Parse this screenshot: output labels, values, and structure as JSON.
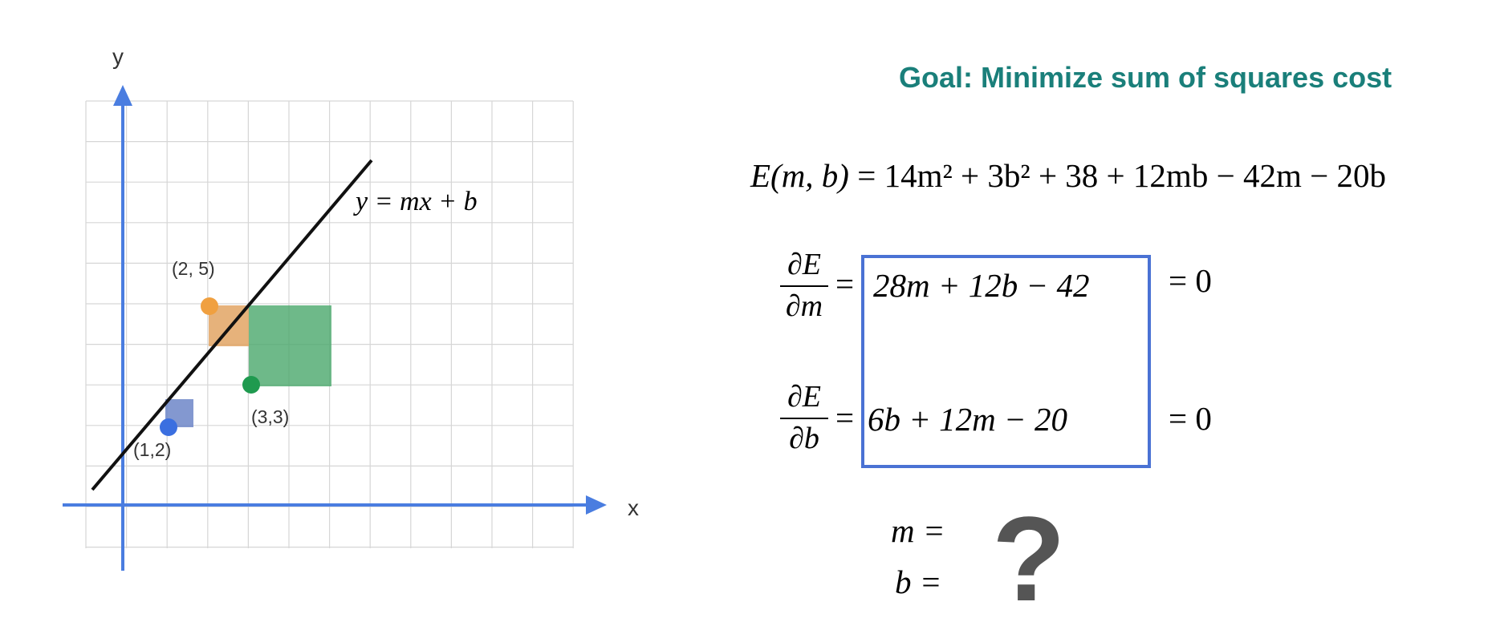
{
  "plot": {
    "x_axis_label": "x",
    "y_axis_label": "y",
    "line_label": "y = mx + b",
    "points": [
      {
        "label": "(1,2)",
        "color": "#3b6fe0"
      },
      {
        "label": "(2, 5)",
        "color": "#f0a040"
      },
      {
        "label": "(3,3)",
        "color": "#1f9a4f"
      }
    ],
    "colors": {
      "axis": "#4a7de0",
      "grid": "#d0d0d0",
      "line": "#111111"
    }
  },
  "goal": "Goal: Minimize sum of squares cost",
  "cost_equation": {
    "lhs": "E(m, b)",
    "rhs": "= 14m² + 3b² + 38 + 12mb − 42m − 20b"
  },
  "partial_m": {
    "numerator": "∂E",
    "denominator": "∂m",
    "equals": "=",
    "expression": "28m + 12b − 42",
    "result": "= 0"
  },
  "partial_b": {
    "numerator": "∂E",
    "denominator": "∂b",
    "equals": "=",
    "expression": "6b + 12m − 20",
    "result": "= 0"
  },
  "solve": {
    "m_line": "m =",
    "b_line": "b =",
    "question_mark": "?"
  }
}
